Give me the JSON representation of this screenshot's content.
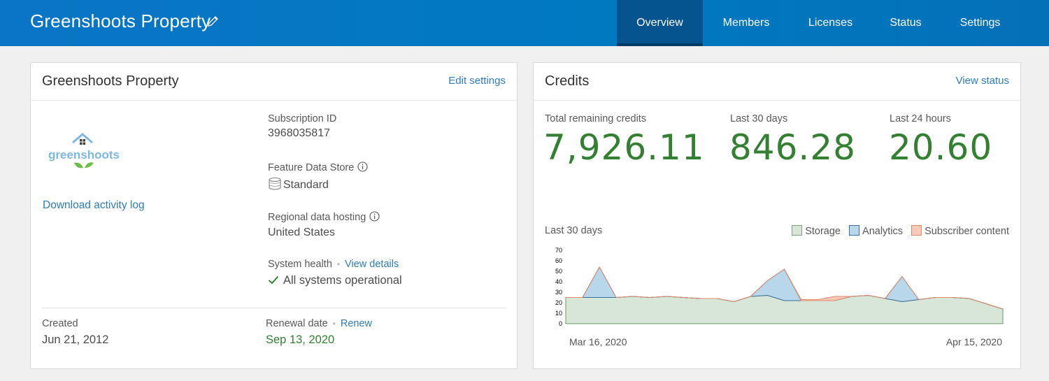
{
  "header": {
    "title": "Greenshoots Property",
    "tabs": [
      {
        "label": "Overview",
        "active": true
      },
      {
        "label": "Members",
        "active": false
      },
      {
        "label": "Licenses",
        "active": false
      },
      {
        "label": "Status",
        "active": false
      },
      {
        "label": "Settings",
        "active": false
      }
    ]
  },
  "org": {
    "title": "Greenshoots Property",
    "edit_link": "Edit settings",
    "logo_text": "greenshoots",
    "download_link": "Download activity log",
    "subscription_id_label": "Subscription ID",
    "subscription_id": "3968035817",
    "feature_store_label": "Feature Data Store",
    "feature_store_value": "Standard",
    "hosting_label": "Regional data hosting",
    "hosting_value": "United States",
    "health_label": "System health",
    "health_link": "View details",
    "health_value": "All systems operational",
    "created_label": "Created",
    "created_value": "Jun 21, 2012",
    "renewal_label": "Renewal date",
    "renew_link": "Renew",
    "renewal_value": "Sep 13, 2020"
  },
  "credits": {
    "title": "Credits",
    "status_link": "View status",
    "total_label": "Total remaining credits",
    "total_value": "7,926.11",
    "d30_label": "Last 30 days",
    "d30_value": "846.28",
    "h24_label": "Last 24 hours",
    "h24_value": "20.60",
    "chart_title": "Last 30 days"
  },
  "colors": {
    "brand": "#0079c1",
    "positive": "#338033",
    "link": "#2e7cb8",
    "storage": "#d7e6d6",
    "analytics": "#b9d7ea",
    "subscriber": "#f6c9b8"
  },
  "chart_data": {
    "type": "area",
    "title": "Last 30 days",
    "x_tick_labels": [
      "Mar 16, 2020",
      "Apr 15, 2020"
    ],
    "ylim": [
      0,
      70
    ],
    "yticks": [
      0,
      10,
      20,
      30,
      40,
      50,
      60,
      70
    ],
    "legend_position": "top-right",
    "series": [
      {
        "name": "Storage",
        "color": "#d7e6d6",
        "stroke": "#6a9a6a",
        "values": [
          25,
          25,
          25,
          25,
          26,
          25,
          26,
          25,
          24,
          24,
          21,
          26,
          27,
          22,
          22,
          22,
          22,
          26,
          27,
          24,
          21,
          23,
          25,
          25,
          24,
          19,
          14
        ]
      },
      {
        "name": "Analytics",
        "color": "#b9d7ea",
        "stroke": "#3b6e99",
        "values": [
          0,
          0,
          29,
          0,
          0,
          0,
          0,
          0,
          0,
          0,
          0,
          0,
          14,
          30,
          0,
          0,
          0,
          0,
          0,
          0,
          24,
          0,
          0,
          0,
          0,
          0,
          0
        ]
      },
      {
        "name": "Subscriber content",
        "color": "#f6c9b8",
        "stroke": "#e08a6a",
        "values": [
          0,
          0,
          0,
          0,
          0,
          0,
          0,
          0,
          0,
          0,
          0,
          0,
          0,
          0,
          1,
          1,
          4,
          0,
          0,
          0,
          0,
          0,
          0,
          0,
          0,
          0,
          0
        ]
      }
    ]
  }
}
